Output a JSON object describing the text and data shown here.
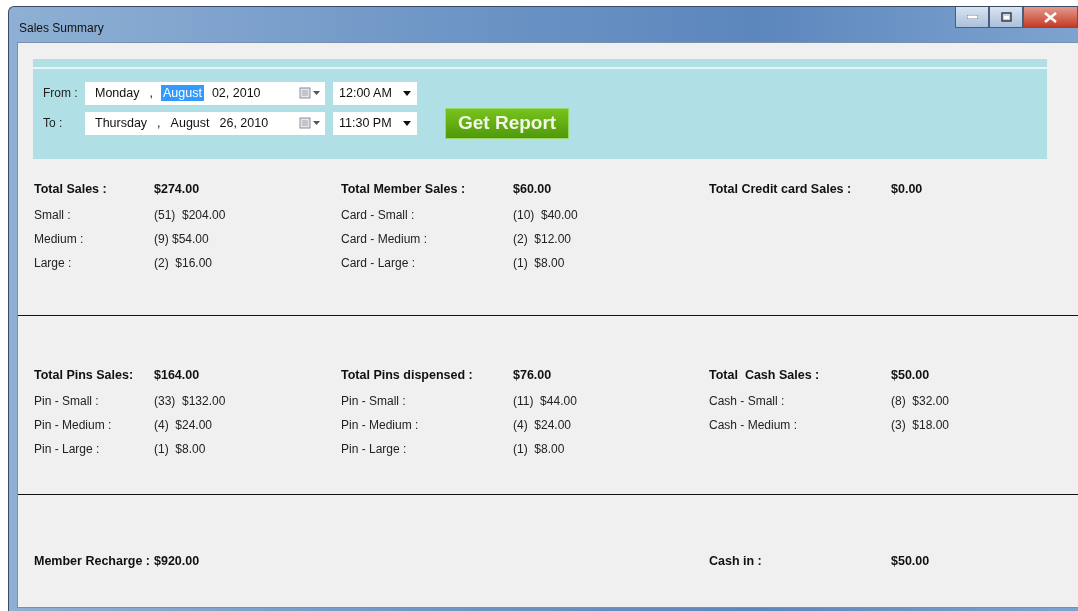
{
  "window": {
    "title": "Sales Summary"
  },
  "filter": {
    "rows": [
      {
        "label": "From :",
        "date_segments": [
          {
            "text": "Monday",
            "selected": false
          },
          {
            "text": ",",
            "selected": false
          },
          {
            "text": "August",
            "selected": true
          },
          {
            "text": "02, 2010",
            "selected": false
          }
        ],
        "time": "12:00 AM"
      },
      {
        "label": "To :",
        "date_segments": [
          {
            "text": "Thursday",
            "selected": false
          },
          {
            "text": ",",
            "selected": false
          },
          {
            "text": "August",
            "selected": false
          },
          {
            "text": "26, 2010",
            "selected": false
          }
        ],
        "time": "11:30 PM"
      }
    ],
    "button": "Get Report"
  },
  "sections": [
    {
      "groups": [
        {
          "title": "Total Sales :",
          "total": "$274.00",
          "rows": [
            {
              "label": "Small :",
              "value": "(51)  $204.00"
            },
            {
              "label": "Medium :",
              "value": "(9) $54.00"
            },
            {
              "label": "Large :",
              "value": "(2)  $16.00"
            }
          ]
        },
        {
          "title": "Total Member Sales :",
          "total": "$60.00",
          "rows": [
            {
              "label": "Card - Small :",
              "value": "(10)  $40.00"
            },
            {
              "label": "Card - Medium :",
              "value": "(2)  $12.00"
            },
            {
              "label": "Card - Large :",
              "value": "(1)  $8.00"
            }
          ]
        },
        {
          "title": "Total Credit card Sales :",
          "total": "$0.00"
        }
      ]
    },
    {
      "groups": [
        {
          "title": "Total Pins Sales:",
          "total": "$164.00",
          "rows": [
            {
              "label": "Pin - Small :",
              "value": "(33)  $132.00"
            },
            {
              "label": "Pin - Medium :",
              "value": "(4)  $24.00"
            },
            {
              "label": "Pin - Large :",
              "value": "(1)  $8.00"
            }
          ]
        },
        {
          "title": "Total Pins dispensed :",
          "total": "$76.00",
          "rows": [
            {
              "label": "Pin - Small :",
              "value": "(11)  $44.00"
            },
            {
              "label": "Pin - Medium :",
              "value": "(4)  $24.00"
            },
            {
              "label": "Pin - Large :",
              "value": "(1)  $8.00"
            }
          ]
        },
        {
          "title": "Total  Cash Sales :",
          "total": "$50.00",
          "rows": [
            {
              "label": "Cash - Small :",
              "value": "(8)  $32.00"
            },
            {
              "label": "Cash - Medium :",
              "value": "(3)  $18.00"
            }
          ]
        }
      ]
    },
    {
      "kind": "footer",
      "groups": [
        {
          "title": "Member Recharge :",
          "total": "$920.00"
        },
        {
          "title": "Cash in :",
          "total": "$50.00"
        }
      ]
    }
  ]
}
